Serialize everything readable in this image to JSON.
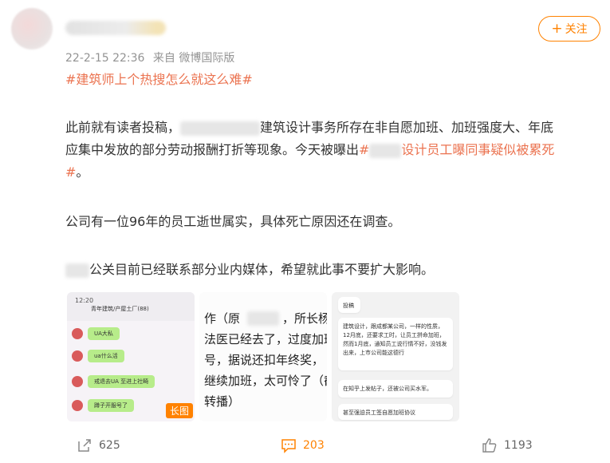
{
  "post": {
    "timestamp": "22-2-15 22:36",
    "source": "来自 微博国际版",
    "follow_label": "关注",
    "hashtag_title": "#建筑师上个热搜怎么就这么难#",
    "p1_a": "此前就有读者投稿，",
    "p1_b": "建筑设计事务所存在非自愿加班、加班强度大、年底",
    "p1_c": "应集中发放的部分劳动报酬打折等现象。今天被曝出",
    "p1_tag_start": "#",
    "p1_tag_end": "设计员工曝同事疑似被累死",
    "p1_tag_line2": "#",
    "p1_end": "。",
    "p2": "公司有一位96年的员工逝世属实，具体死亡原因还在调查。",
    "p3": "公关目前已经联系部分业内媒体，希望就此事不要扩大影响。"
  },
  "images": {
    "img1": {
      "time": "12:20",
      "title": "青年建筑/产屋土厂(88)",
      "bubbles": [
        "UA大私",
        "ua什么活",
        "戒退去UA 至进上社畸",
        "蹲子开服号了"
      ],
      "badge": "长图"
    },
    "img2": {
      "lines": [
        "作（原",
        "，所长杨进",
        "法医已经去了，过度加班",
        "号，据说还扣年终奖，",
        "继续加班，太可怜了（截",
        "转播）"
      ]
    },
    "img3": {
      "label": "投稿",
      "card_text": "建筑设计，跟成都某公司，一样的性质，12月底，还要求工时，让员工拼命加班，然而1月底，通知员工说行情不好，没钱发出来，上市公司能这德行",
      "card2": "在知乎上发帖子，还被公司买水军。",
      "card3": "甚至强迫员工签自愿加班协议"
    }
  },
  "actions": {
    "share_count": "625",
    "comment_count": "203",
    "like_count": "1193"
  },
  "colors": {
    "accent": "#ff8200",
    "hashtag": "#eb7350"
  }
}
